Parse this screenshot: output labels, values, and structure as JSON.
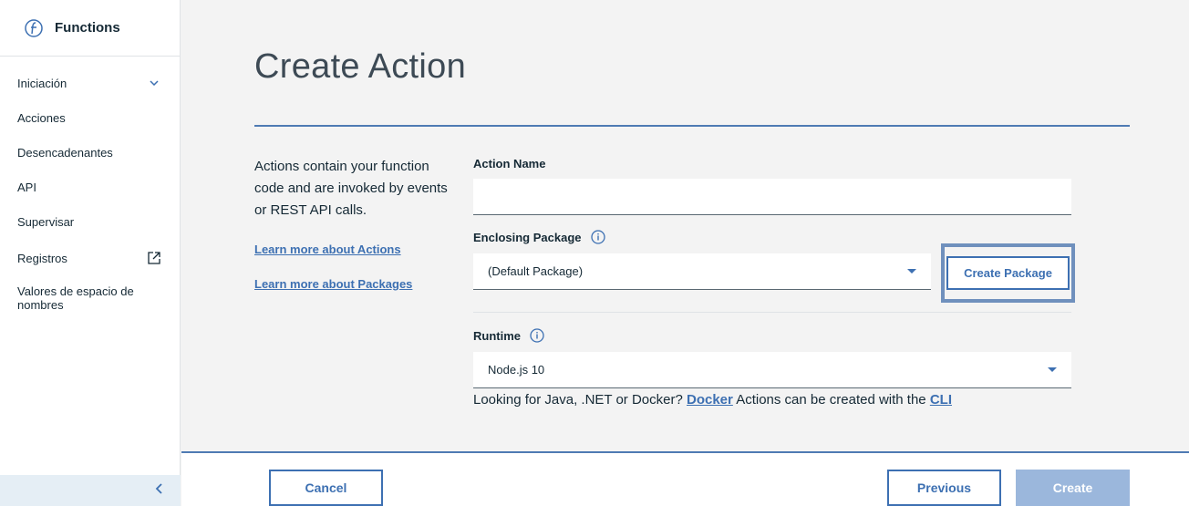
{
  "sidebar": {
    "title": "Functions",
    "items": [
      {
        "label": "Iniciación"
      },
      {
        "label": "Acciones"
      },
      {
        "label": "Desencadenantes"
      },
      {
        "label": "API"
      },
      {
        "label": "Supervisar"
      },
      {
        "label": "Registros"
      },
      {
        "label": "Valores de espacio de nombres"
      }
    ]
  },
  "main": {
    "title": "Create Action",
    "description": "Actions contain your function code and are invoked by events or REST API calls.",
    "links": {
      "actions": "Learn more about Actions",
      "packages": "Learn more about Packages"
    },
    "action_name": {
      "label": "Action Name",
      "value": ""
    },
    "package": {
      "label": "Enclosing Package",
      "selected": "(Default Package)",
      "create_button": "Create Package"
    },
    "runtime": {
      "label": "Runtime",
      "selected": "Node.js 10"
    },
    "note": {
      "prefix": "Looking for Java, .NET or Docker? ",
      "docker_link": "Docker",
      "middle": " Actions can be created with the ",
      "cli_link": "CLI"
    }
  },
  "footer": {
    "cancel": "Cancel",
    "previous": "Previous",
    "create": "Create"
  },
  "colors": {
    "accent": "#3d70b2",
    "focus_ring": "#6f90bd",
    "disabled_primary": "#9bb7dc"
  }
}
